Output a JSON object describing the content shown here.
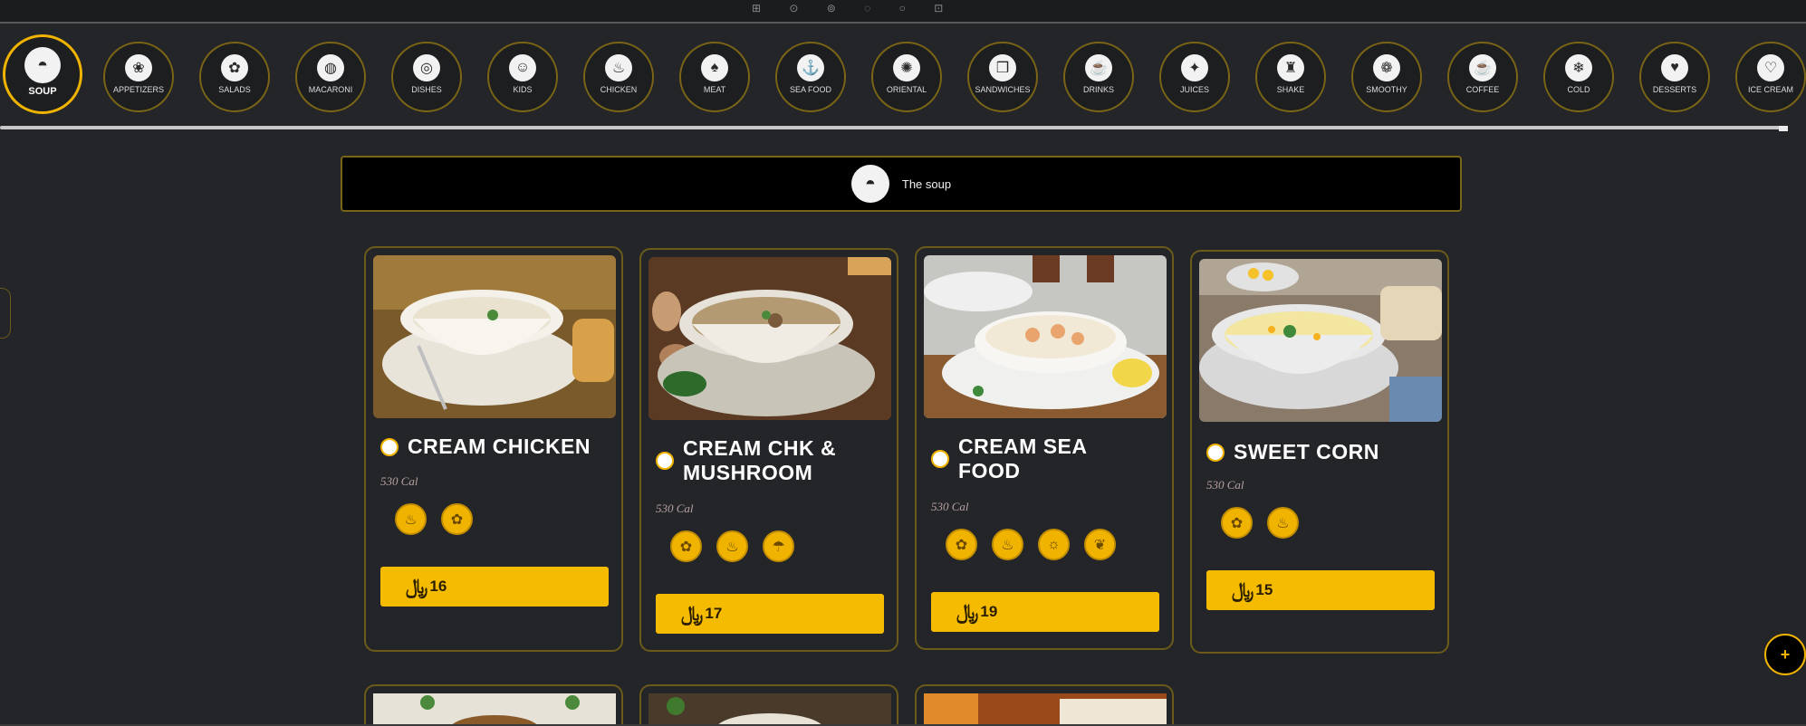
{
  "colors": {
    "accent": "#f5bb00",
    "background": "#232528",
    "header_bg": "#000000",
    "border_gold": "#6b5a1a"
  },
  "categories": [
    {
      "label": "SOUP",
      "icon": "soup-bowl-icon",
      "active": true
    },
    {
      "label": "APPETIZERS",
      "icon": "appetizer-icon"
    },
    {
      "label": "SALADS",
      "icon": "salad-icon"
    },
    {
      "label": "MACARONI",
      "icon": "pasta-icon"
    },
    {
      "label": "DISHES",
      "icon": "dish-icon"
    },
    {
      "label": "KIDS",
      "icon": "kids-meal-icon"
    },
    {
      "label": "CHICKEN",
      "icon": "chicken-icon"
    },
    {
      "label": "MEAT",
      "icon": "meat-icon"
    },
    {
      "label": "SEA FOOD",
      "icon": "seafood-icon"
    },
    {
      "label": "ORIENTAL",
      "icon": "oriental-icon"
    },
    {
      "label": "SANDWICHES",
      "icon": "sandwich-icon"
    },
    {
      "label": "DRINKS",
      "icon": "drink-icon"
    },
    {
      "label": "JUICES",
      "icon": "juice-icon"
    },
    {
      "label": "SHAKE",
      "icon": "shake-icon"
    },
    {
      "label": "SMOOTHY",
      "icon": "smoothie-icon"
    },
    {
      "label": "COFFEE",
      "icon": "coffee-icon"
    },
    {
      "label": "COLD",
      "icon": "cold-drink-icon"
    },
    {
      "label": "DESSERTS",
      "icon": "dessert-icon"
    },
    {
      "label": "ICE CREAM",
      "icon": "ice-cream-icon"
    }
  ],
  "section": {
    "title": "The soup",
    "icon": "soup-bowl-icon"
  },
  "products": [
    {
      "name": "CREAM CHICKEN",
      "calories": "530 Cal",
      "price": "16",
      "currency_symbol": "⃁",
      "allergens": [
        "dairy-icon",
        "gluten-icon"
      ]
    },
    {
      "name": "CREAM CHK & MUSHROOM",
      "calories": "530 Cal",
      "price": "17",
      "currency_symbol": "⃁",
      "allergens": [
        "gluten-icon",
        "dairy-icon",
        "mushroom-icon"
      ]
    },
    {
      "name": "CREAM SEA FOOD",
      "calories": "530 Cal",
      "price": "19",
      "currency_symbol": "⃁",
      "allergens": [
        "gluten-icon",
        "dairy-icon",
        "shellfish-icon",
        "fish-icon"
      ]
    },
    {
      "name": "SWEET CORN",
      "calories": "530 Cal",
      "price": "15",
      "currency_symbol": "⃁",
      "allergens": [
        "gluten-icon",
        "dairy-icon"
      ]
    }
  ],
  "fab": {
    "label": "+"
  }
}
